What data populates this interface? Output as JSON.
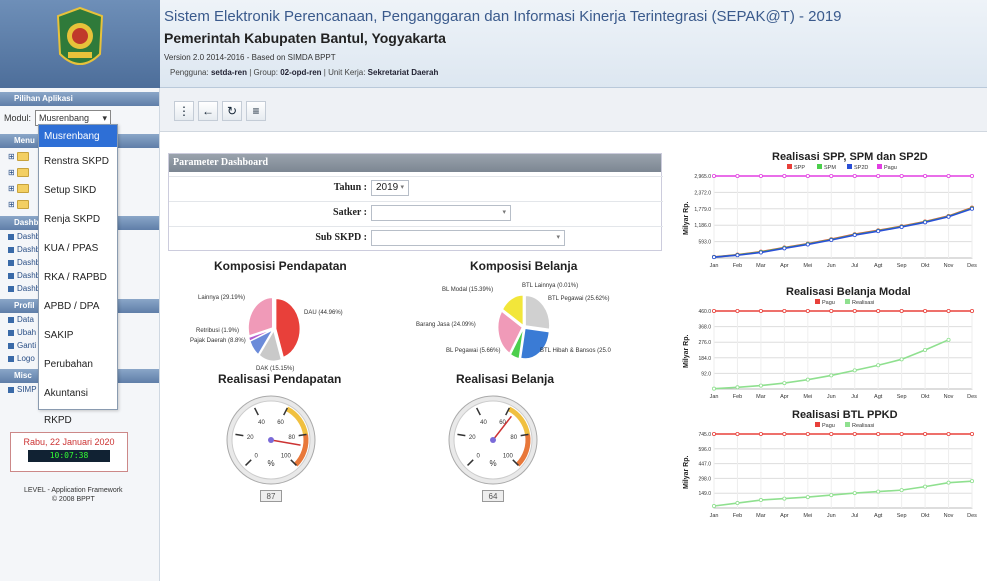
{
  "header": {
    "app_title": "Sistem Elektronik Perencanaan, Penganggaran dan Informasi Kinerja Terintegrasi (SEPAK@T) - 2019",
    "org_title": "Pemerintah Kabupaten Bantul, Yogyakarta",
    "version": "Version 2.0 2014-2016 - Based on SIMDA BPPT",
    "user_prefix": "Pengguna:",
    "user": "setda-ren",
    "group_prefix": "| Group:",
    "group": "02-opd-ren",
    "unit_prefix": "| Unit Kerja:",
    "unit": "Sekretariat Daerah"
  },
  "sidebar": {
    "pilihan_title": "Pilihan Aplikasi",
    "modul_label": "Modul:",
    "modul_value": "Musrenbang",
    "tree_items": [
      "Menu",
      "",
      "",
      ""
    ],
    "dash_title": "Dashboard",
    "dash_links": [
      "Dashb",
      "Dashb",
      "Dashb",
      "Dashb",
      "Dashb"
    ],
    "profil_title": "Profil",
    "profil_links": [
      "Data",
      "Ubah",
      "Ganti",
      "Logo"
    ],
    "misc_title": "Misc",
    "misc_links": [
      "SIMP"
    ]
  },
  "dropdown": {
    "options": [
      "Musrenbang",
      "Renstra SKPD",
      "Setup SIKD",
      "Renja SKPD",
      "KUA / PPAS",
      "RKA / RAPBD",
      "APBD / DPA",
      "SAKIP",
      "Perubahan",
      "Akuntansi",
      "RKPD"
    ]
  },
  "clock": {
    "date": "Rabu, 22 Januari 2020",
    "time": "10:07:38"
  },
  "footer": {
    "line1": "LEVEL - Application Framework",
    "line2": "© 2008 BPPT"
  },
  "toolbar": {
    "icons": [
      "more-icon",
      "back-icon",
      "refresh-icon",
      "list-icon"
    ]
  },
  "param": {
    "title": "Parameter Dashboard",
    "tahun_label": "Tahun :",
    "tahun_value": "2019",
    "satker_label": "Satker :",
    "satker_value": "",
    "subskpd_label": "Sub SKPD :",
    "subskpd_value": ""
  },
  "chart_data": [
    {
      "type": "pie",
      "title": "Komposisi Pendapatan",
      "slices": [
        {
          "label": "DAU (44.96%)",
          "value": 44.96,
          "color": "#e8403a"
        },
        {
          "label": "DAK (15.15%)",
          "value": 15.15,
          "color": "#c9c9c9"
        },
        {
          "label": "Pajak Daerah (8.8%)",
          "value": 8.8,
          "color": "#6b8bd9"
        },
        {
          "label": "Retribusi (1.9%)",
          "value": 1.9,
          "color": "#b45fcf"
        },
        {
          "label": "Lainnya (29.19%)",
          "value": 29.19,
          "color": "#f09ab8"
        }
      ]
    },
    {
      "type": "pie",
      "title": "Komposisi Belanja",
      "slices": [
        {
          "label": "BTL Lainnya (0.01%)",
          "value": 0.01,
          "color": "#aaaaaa"
        },
        {
          "label": "BTL Pegawai (25.62%)",
          "value": 25.62,
          "color": "#d0d0d0"
        },
        {
          "label": "BTL Hibah & Bansos (25.0",
          "value": 25.0,
          "color": "#3a7bd5"
        },
        {
          "label": "BL Pegawai (5.66%)",
          "value": 5.66,
          "color": "#4ccf4c"
        },
        {
          "label": "Barang Jasa (24.09%)",
          "value": 24.09,
          "color": "#f09ab8"
        },
        {
          "label": "BL Modal (15.39%)",
          "value": 15.39,
          "color": "#f2e63a"
        }
      ]
    },
    {
      "type": "gauge",
      "title": "Realisasi Pendapatan",
      "value": 87,
      "min": 0,
      "max": 100,
      "unit": "%",
      "ticks": [
        "0",
        "20",
        "40",
        "60",
        "80",
        "100"
      ]
    },
    {
      "type": "gauge",
      "title": "Realisasi Belanja",
      "value": 64,
      "min": 0,
      "max": 100,
      "unit": "%",
      "ticks": [
        "0",
        "20",
        "40",
        "60",
        "80",
        "100"
      ]
    },
    {
      "type": "line",
      "title": "Realisasi SPP, SPM dan SP2D",
      "ylabel": "Milyar Rp.",
      "categories": [
        "Jan",
        "Feb",
        "Mar",
        "Apr",
        "Mei",
        "Jun",
        "Jul",
        "Agt",
        "Sep",
        "Okt",
        "Nov",
        "Des"
      ],
      "yticks": [
        "593.0",
        "1,186.0",
        "1,779.0",
        "2,372.0",
        "2,965.0"
      ],
      "ylim": [
        0,
        2965
      ],
      "series": [
        {
          "name": "SPP",
          "color": "#e8403a",
          "values": [
            40,
            120,
            230,
            380,
            520,
            680,
            860,
            1000,
            1150,
            1320,
            1520,
            1820
          ]
        },
        {
          "name": "SPM",
          "color": "#4ccf4c",
          "values": [
            35,
            110,
            215,
            365,
            505,
            665,
            845,
            985,
            1135,
            1305,
            1505,
            1800
          ]
        },
        {
          "name": "SP2D",
          "color": "#2a4fd6",
          "values": [
            30,
            100,
            200,
            350,
            490,
            650,
            830,
            970,
            1120,
            1290,
            1490,
            1780
          ]
        },
        {
          "name": "Pagu",
          "color": "#e23ee2",
          "values": [
            2965,
            2965,
            2965,
            2965,
            2965,
            2965,
            2965,
            2965,
            2965,
            2965,
            2965,
            2965
          ]
        }
      ]
    },
    {
      "type": "line",
      "title": "Realisasi Belanja Modal",
      "ylabel": "Milyar Rp.",
      "categories": [
        "Jan",
        "Feb",
        "Mar",
        "Apr",
        "Mei",
        "Jun",
        "Jul",
        "Agt",
        "Sep",
        "Okt",
        "Nov",
        "Des"
      ],
      "yticks": [
        "92.0",
        "184.0",
        "276.0",
        "368.0",
        "460.0"
      ],
      "ylim": [
        0,
        460
      ],
      "series": [
        {
          "name": "Pagu",
          "color": "#e8403a",
          "values": [
            460,
            460,
            460,
            460,
            460,
            460,
            460,
            460,
            460,
            460,
            460,
            460
          ]
        },
        {
          "name": "Realisasi",
          "color": "#8fe08f",
          "values": [
            2,
            10,
            20,
            35,
            55,
            80,
            110,
            140,
            175,
            230,
            290,
            null
          ]
        }
      ]
    },
    {
      "type": "line",
      "title": "Realisasi BTL PPKD",
      "ylabel": "Milyar Rp.",
      "categories": [
        "Jan",
        "Feb",
        "Mar",
        "Apr",
        "Mei",
        "Jun",
        "Jul",
        "Agt",
        "Sep",
        "Okt",
        "Nov",
        "Des"
      ],
      "yticks": [
        "149.0",
        "298.0",
        "447.0",
        "596.0",
        "745.0"
      ],
      "ylim": [
        0,
        745
      ],
      "series": [
        {
          "name": "Pagu",
          "color": "#e8403a",
          "values": [
            745,
            745,
            745,
            745,
            745,
            745,
            745,
            745,
            745,
            745,
            745,
            745
          ]
        },
        {
          "name": "Realisasi",
          "color": "#8fe08f",
          "values": [
            20,
            50,
            80,
            95,
            110,
            130,
            150,
            165,
            180,
            215,
            255,
            270
          ]
        }
      ]
    }
  ]
}
